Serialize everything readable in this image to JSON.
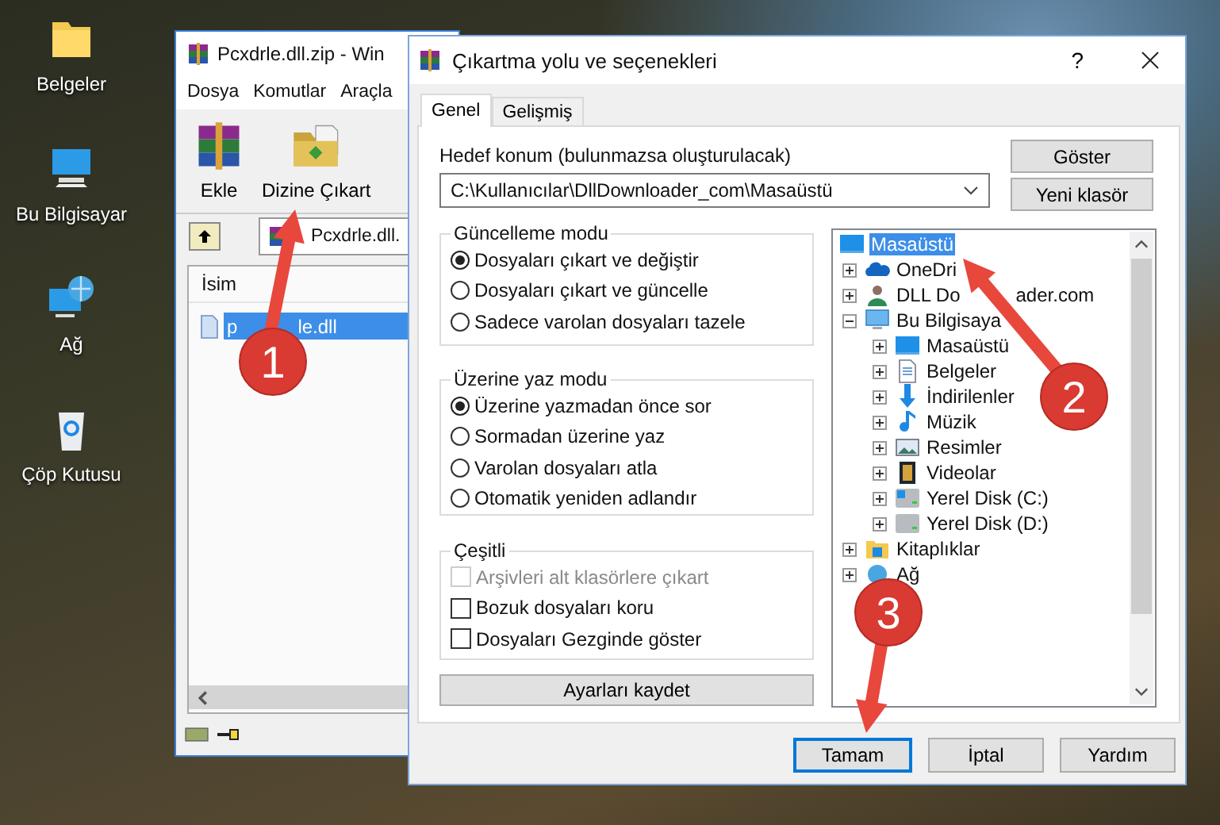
{
  "desktop": {
    "icons": [
      {
        "kind": "documents",
        "label": "Belgeler"
      },
      {
        "kind": "computer",
        "label": "Bu Bilgisayar"
      },
      {
        "kind": "network",
        "label": "Ağ"
      },
      {
        "kind": "recycle",
        "label": "Çöp Kutusu"
      }
    ]
  },
  "archive_window": {
    "title": "Pcxdrle.dll.zip - Win",
    "menu": [
      "Dosya",
      "Komutlar",
      "Araçla"
    ],
    "toolbar": [
      {
        "kind": "add",
        "label": "Ekle"
      },
      {
        "kind": "extract",
        "label": "Dizine Çıkart"
      }
    ],
    "path": "Pcxdrle.dll.",
    "column": "İsim",
    "files": [
      {
        "name_start": "p",
        "name_end": "le.dll",
        "selected": true
      }
    ]
  },
  "dialog": {
    "title": "Çıkartma yolu ve seçenekleri",
    "help": "?",
    "tabs": [
      {
        "label": "Genel",
        "selected": true
      },
      {
        "label": "Gelişmiş",
        "selected": false
      }
    ],
    "destination": {
      "label": "Hedef konum (bulunmazsa oluşturulacak)",
      "value": "C:\\Kullanıcılar\\DllDownloader_com\\Masaüstü"
    },
    "side_buttons": [
      "Göster",
      "Yeni klasör"
    ],
    "groups": [
      {
        "title": "Güncelleme modu",
        "options": [
          {
            "kind": "radio",
            "label": "Dosyaları çıkart ve değiştir",
            "selected": true
          },
          {
            "kind": "radio",
            "label": "Dosyaları çıkart ve güncelle",
            "selected": false
          },
          {
            "kind": "radio",
            "label": "Sadece varolan dosyaları tazele",
            "selected": false
          }
        ]
      },
      {
        "title": "Üzerine yaz modu",
        "options": [
          {
            "kind": "radio",
            "label": "Üzerine yazmadan önce sor",
            "selected": true
          },
          {
            "kind": "radio",
            "label": "Sormadan üzerine yaz",
            "selected": false
          },
          {
            "kind": "radio",
            "label": "Varolan dosyaları atla",
            "selected": false
          },
          {
            "kind": "radio",
            "label": "Otomatik yeniden adlandır",
            "selected": false
          }
        ]
      },
      {
        "title": "Çeşitli",
        "options": [
          {
            "kind": "checkbox",
            "label": "Arşivleri alt klasörlere çıkart",
            "checked": false,
            "disabled": true
          },
          {
            "kind": "checkbox",
            "label": "Bozuk dosyaları koru",
            "checked": false,
            "disabled": false
          },
          {
            "kind": "checkbox",
            "label": "Dosyaları Gezginde göster",
            "checked": false,
            "disabled": false
          }
        ]
      }
    ],
    "save_button": "Ayarları kaydet",
    "tree": [
      {
        "kind": "desktop",
        "label": "Masaüstü",
        "selected": true,
        "children": [
          {
            "kind": "cloud",
            "label": "OneDri",
            "expanded": false,
            "selected": false
          },
          {
            "kind": "person",
            "label": "DLL Do",
            "label_tail": "ader.com",
            "expanded": false,
            "selected": false
          },
          {
            "kind": "computer",
            "label": "Bu Bilgisaya",
            "expanded": true,
            "selected": false,
            "children": [
              {
                "kind": "desktop",
                "label": "Masaüstü",
                "expanded": false,
                "selected": false
              },
              {
                "kind": "documents",
                "label": "Belgeler",
                "expanded": false,
                "selected": false
              },
              {
                "kind": "downloads",
                "label": "İndirilenler",
                "expanded": false,
                "selected": false
              },
              {
                "kind": "music",
                "label": "Müzik",
                "expanded": false,
                "selected": false
              },
              {
                "kind": "pictures",
                "label": "Resimler",
                "expanded": false,
                "selected": false
              },
              {
                "kind": "videos",
                "label": "Videolar",
                "expanded": false,
                "selected": false
              },
              {
                "kind": "system-drive",
                "label": "Yerel Disk (C:)",
                "expanded": false,
                "selected": false
              },
              {
                "kind": "drive",
                "label": "Yerel Disk (D:)",
                "expanded": false,
                "selected": false
              }
            ]
          },
          {
            "kind": "library",
            "label": "Kitaplıklar",
            "expanded": false,
            "selected": false
          },
          {
            "kind": "network",
            "label": "Ağ",
            "expanded": false,
            "selected": false
          }
        ]
      }
    ],
    "buttons": [
      {
        "label": "Tamam",
        "default": true
      },
      {
        "label": "İptal",
        "default": false
      },
      {
        "label": "Yardım",
        "default": false
      }
    ]
  },
  "annotations": [
    {
      "number": "1"
    },
    {
      "number": "2"
    },
    {
      "number": "3"
    }
  ]
}
